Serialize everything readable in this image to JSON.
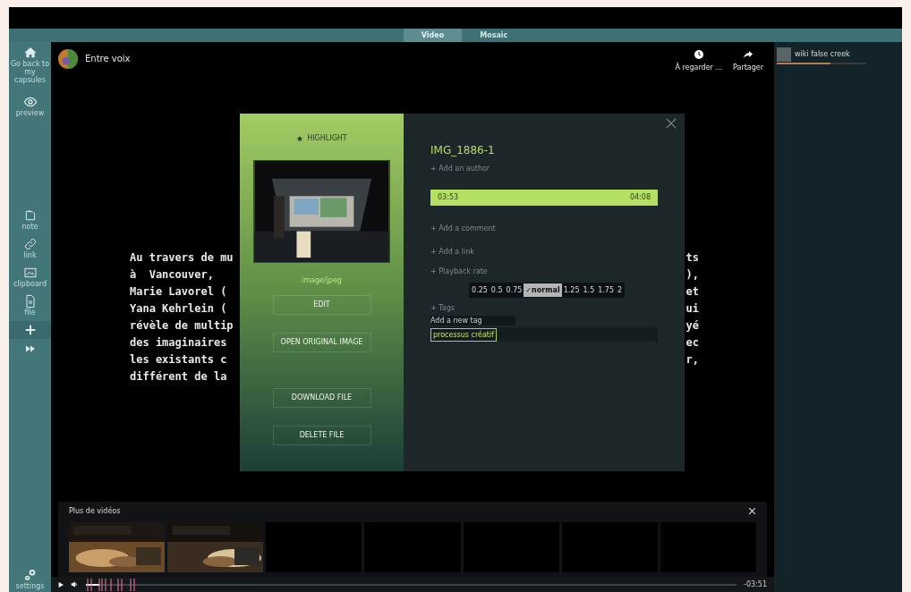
{
  "tabs": [
    {
      "label": "Video",
      "selected": true
    },
    {
      "label": "Mosaic",
      "selected": false
    }
  ],
  "sidebar": {
    "top": [
      {
        "kind": "home",
        "label": "Go back to my capsules"
      },
      {
        "kind": "eye",
        "label": "preview"
      }
    ],
    "tools": [
      {
        "kind": "note",
        "label": "note",
        "selected": false
      },
      {
        "kind": "link",
        "label": "link",
        "selected": false
      },
      {
        "kind": "clipboard",
        "label": "clipboard",
        "selected": false
      },
      {
        "kind": "file",
        "label": "file",
        "selected": false
      },
      {
        "kind": "plus",
        "selected": true
      },
      {
        "kind": "forward",
        "selected": false
      }
    ],
    "bottom": {
      "label": "settings"
    }
  },
  "header": {
    "title": "Entre voix",
    "actions": [
      {
        "kind": "clock",
        "label": "À regarder ..."
      },
      {
        "kind": "share",
        "label": "Partager"
      }
    ]
  },
  "text_lines": [
    {
      "left": "Au travers de mu",
      "right": "ts"
    },
    {
      "left": "à  Vancouver,",
      "right": "),"
    },
    {
      "left": "Marie Lavorel (",
      "right": "et"
    },
    {
      "left": "Yana Kehrlein (",
      "right": "ui"
    },
    {
      "left": "révèle de multip",
      "right": "yé"
    },
    {
      "left": "des imaginaires",
      "right": "ec"
    },
    {
      "left": "les existants c",
      "right": "r,"
    },
    {
      "left": "différent de la"
    }
  ],
  "modal": {
    "highlight": "HIGHLIGHT",
    "mime": "image/jpeg",
    "buttons": [
      "EDIT",
      "OPEN ORIGINAL IMAGE",
      "DOWNLOAD FILE",
      "DELETE FILE"
    ],
    "title": "IMG_1886-1",
    "author": "+ Add an author",
    "time_start": "03:53",
    "time_end": "04:08",
    "comment": "+ Add a comment",
    "link": "+ Add a link",
    "playback_label": "+ Playback rate",
    "rates": [
      {
        "label": "0.25",
        "selected": false
      },
      {
        "label": "0.5",
        "selected": false
      },
      {
        "label": "0.75",
        "selected": false
      },
      {
        "label": "✓normal",
        "selected": true
      },
      {
        "label": "1.25",
        "selected": false
      },
      {
        "label": "1.5",
        "selected": false
      },
      {
        "label": "1.75",
        "selected": false
      },
      {
        "label": "2",
        "selected": false
      }
    ],
    "tags_label": "+ Tags",
    "tag_placeholder": "Add a new tag",
    "tags": [
      "processus créatif"
    ]
  },
  "more_videos": {
    "title": "Plus de vidéos",
    "thumbnails": [
      {
        "kind": "picture"
      },
      {
        "kind": "picture"
      },
      {
        "kind": "empty"
      },
      {
        "kind": "empty"
      },
      {
        "kind": "empty"
      },
      {
        "kind": "empty"
      },
      {
        "kind": "empty"
      }
    ]
  },
  "player": {
    "level": 0.02,
    "time": "-03:51"
  },
  "playlist": [
    {
      "title": "wiki false creek",
      "level": 0.6
    }
  ]
}
